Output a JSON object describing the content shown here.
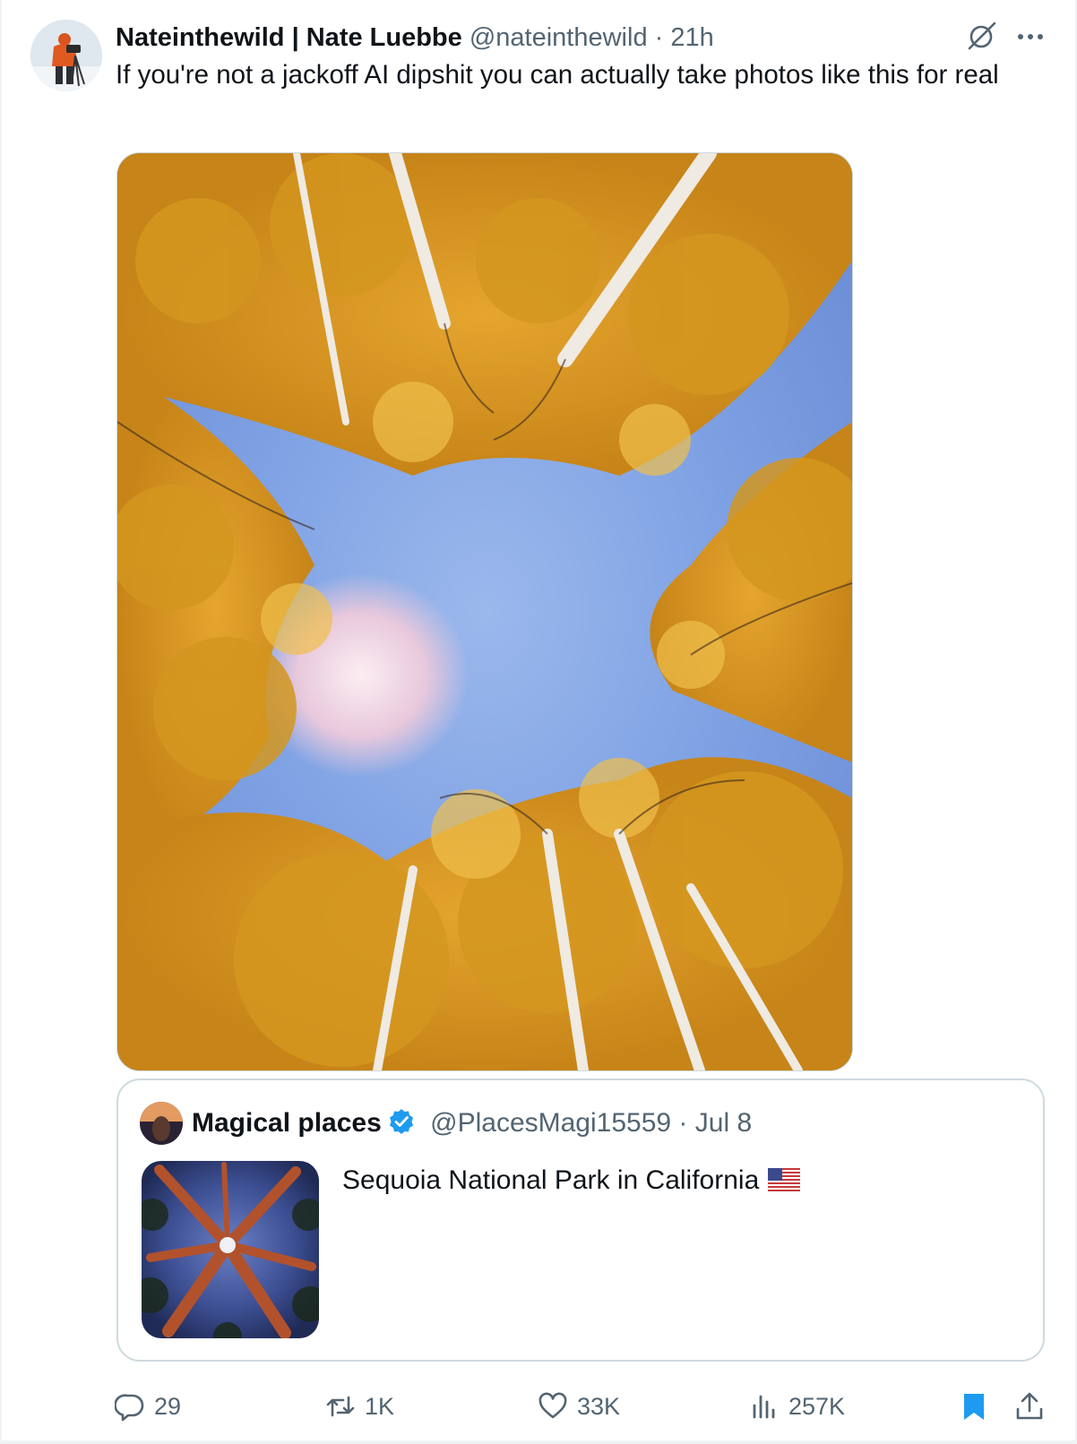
{
  "tweet": {
    "display_name": "Nateinthewild | Nate Luebbe",
    "handle": "@nateinthewild",
    "separator": "·",
    "time": "21h",
    "text": "If you're not a jackoff AI dipshit you can actually take photos like this for real",
    "icons": [
      "grok-icon",
      "more-icon"
    ]
  },
  "quote": {
    "display_name": "Magical places",
    "verified": true,
    "handle": "@PlacesMagi15559",
    "separator": "·",
    "date": "Jul 8",
    "text": "Sequoia National Park in California",
    "flag_icon": "us-flag-icon"
  },
  "actions": {
    "replies": "29",
    "reposts": "1K",
    "likes": "33K",
    "views": "257K"
  },
  "colors": {
    "text_primary": "#0f1419",
    "text_secondary": "#536471",
    "accent": "#1d9bf0",
    "border": "#cfd9de"
  }
}
